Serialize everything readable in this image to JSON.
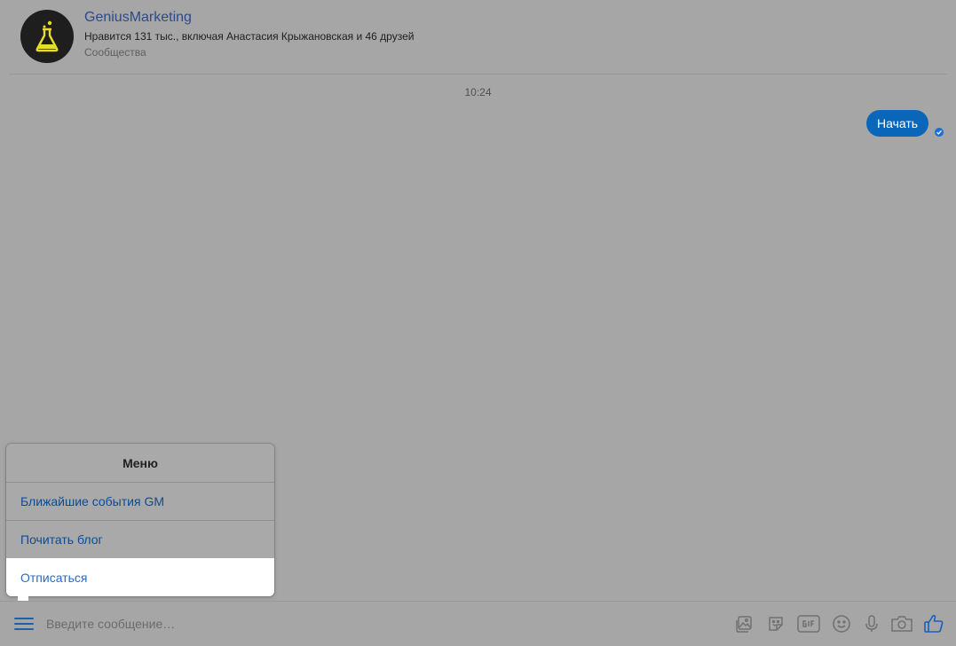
{
  "header": {
    "title": "GeniusMarketing",
    "likes_text": "Нравится 131 тыс., включая Анастасия Крыжановская и 46 друзей",
    "category": "Сообщества",
    "avatar_icon": "flask-icon"
  },
  "chat": {
    "timestamp": "10:24",
    "messages": [
      {
        "text": "Начать",
        "status": "read"
      }
    ]
  },
  "menu": {
    "title": "Меню",
    "items": [
      {
        "label": "Ближайшие события GM"
      },
      {
        "label": "Почитать блог"
      },
      {
        "label": "Отписаться",
        "active": true
      }
    ]
  },
  "composer": {
    "placeholder": "Введите сообщение…",
    "value": "",
    "tools": [
      "photo-icon",
      "sticker-icon",
      "gif-icon",
      "emoji-icon",
      "microphone-icon",
      "camera-icon",
      "like-icon"
    ]
  },
  "colors": {
    "background": "#a6a6a6",
    "accent": "#0a66b8",
    "link": "#0d4b93",
    "title": "#2d4a8a",
    "menu_active_bg": "#ffffff"
  }
}
